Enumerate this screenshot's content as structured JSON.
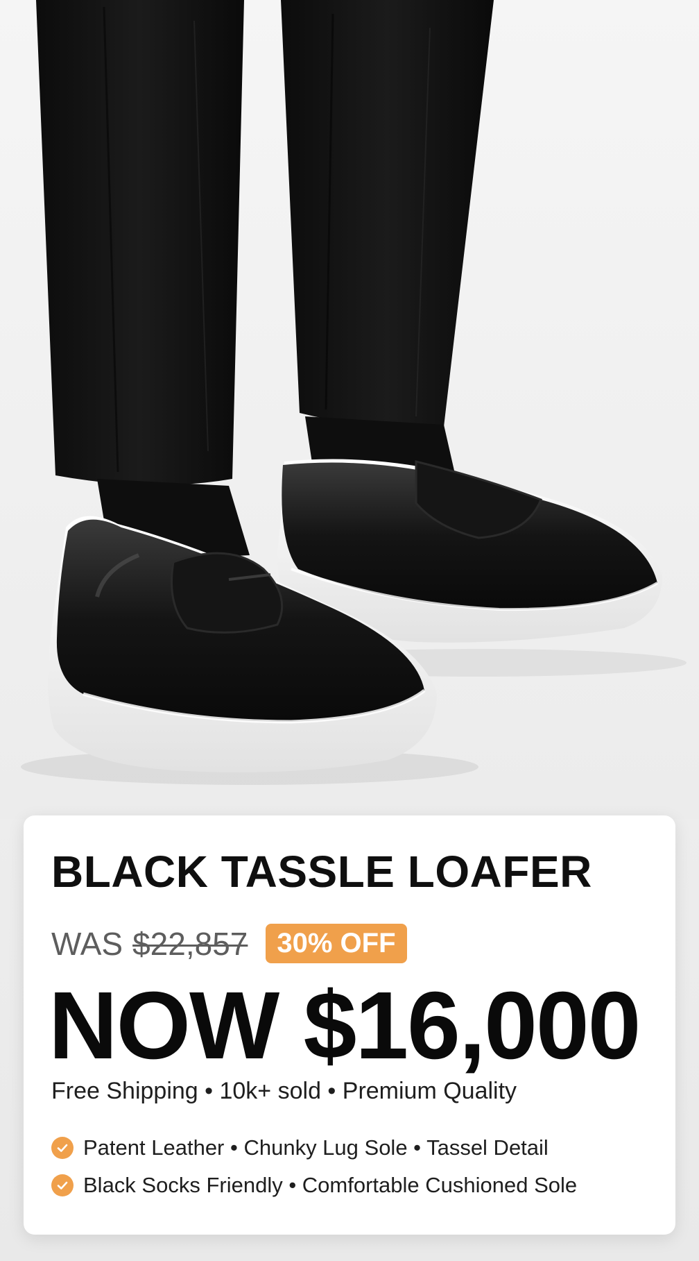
{
  "product": {
    "title": "BLACK TASSLE LOAFER",
    "was_label": "WAS",
    "was_price": "$22,857",
    "discount_badge": "30% OFF",
    "now_price": "NOW $16,000",
    "meta": "Free Shipping • 10k+ sold • Premium Quality",
    "features": [
      "Patent Leather • Chunky Lug Sole • Tassel Detail",
      "Black Socks Friendly • Comfortable Cushioned Sole"
    ]
  },
  "colors": {
    "accent": "#f0a04b",
    "text_dark": "#0f0f0f",
    "text_muted": "#5d5d5d",
    "background": "#efefef"
  },
  "icons": [
    "check-circle-icon"
  ]
}
